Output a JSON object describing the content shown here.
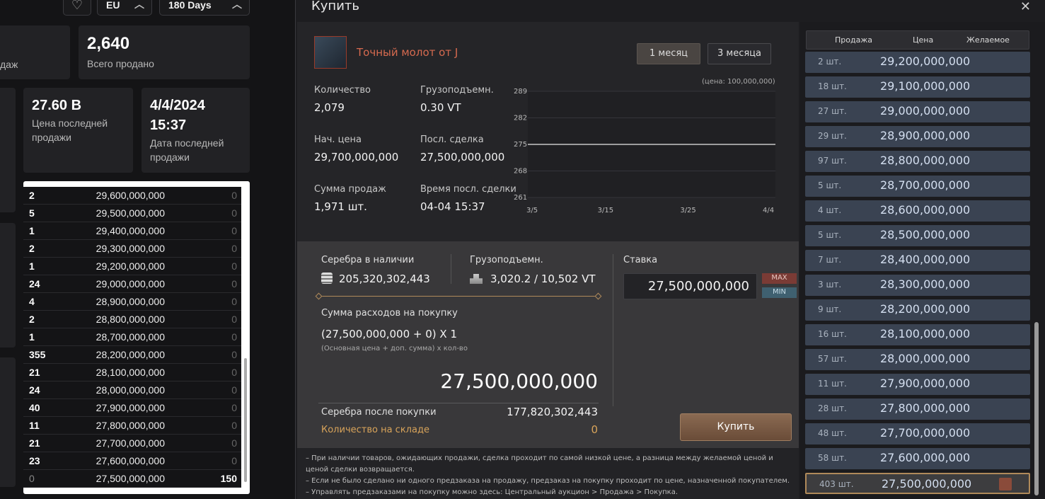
{
  "left_page": {
    "region": "EU",
    "period": "180 Days",
    "total_sold_value": "2,640",
    "total_sold_label": "Всего продано",
    "partial_label": "дaж",
    "last_price_value": "27.60 B",
    "last_price_label_1": "Цена последней",
    "last_price_label_2": "продажи",
    "last_date_value_1": "4/4/2024",
    "last_date_value_2": "15:37",
    "last_date_label_1": "Дата последней",
    "last_date_label_2": "продажи",
    "rows": [
      {
        "qty": "2",
        "price": "29,600,000,000",
        "wish": "0"
      },
      {
        "qty": "5",
        "price": "29,500,000,000",
        "wish": "0"
      },
      {
        "qty": "1",
        "price": "29,400,000,000",
        "wish": "0"
      },
      {
        "qty": "2",
        "price": "29,300,000,000",
        "wish": "0"
      },
      {
        "qty": "1",
        "price": "29,200,000,000",
        "wish": "0"
      },
      {
        "qty": "24",
        "price": "29,000,000,000",
        "wish": "0"
      },
      {
        "qty": "4",
        "price": "28,900,000,000",
        "wish": "0"
      },
      {
        "qty": "2",
        "price": "28,800,000,000",
        "wish": "0"
      },
      {
        "qty": "1",
        "price": "28,700,000,000",
        "wish": "0"
      },
      {
        "qty": "355",
        "price": "28,200,000,000",
        "wish": "0"
      },
      {
        "qty": "21",
        "price": "28,100,000,000",
        "wish": "0"
      },
      {
        "qty": "24",
        "price": "28,000,000,000",
        "wish": "0"
      },
      {
        "qty": "40",
        "price": "27,900,000,000",
        "wish": "0"
      },
      {
        "qty": "11",
        "price": "27,800,000,000",
        "wish": "0"
      },
      {
        "qty": "21",
        "price": "27,700,000,000",
        "wish": "0"
      },
      {
        "qty": "23",
        "price": "27,600,000,000",
        "wish": "0"
      },
      {
        "qty": "0",
        "price": "27,500,000,000",
        "wish": "150"
      }
    ]
  },
  "dialog": {
    "title": "Купить",
    "close": "✕",
    "item_name": "Точный молот от J",
    "tab_1": "1 месяц",
    "tab_3": "3 месяца",
    "chart_note": "(цена: 100,000,000)",
    "qty_label": "Количество",
    "qty_value": "2,079",
    "weight_label": "Грузоподъемн.",
    "weight_value": "0.30 VT",
    "start_price_label": "Нач. цена",
    "start_price_value": "29,700,000,000",
    "last_deal_label": "Посл. сделка",
    "last_deal_value": "27,500,000,000",
    "sales_label": "Сумма продаж",
    "sales_value": "1,971 шт.",
    "last_time_label": "Время посл. сделки",
    "last_time_value": "04-04 15:37",
    "silver_label": "Серебра в наличии",
    "silver_value": "205,320,302,443",
    "capacity_label": "Грузоподъемн.",
    "capacity_value": "3,020.2 / 10,502 VT",
    "bid_label": "Ставка",
    "bid_value": "27,500,000,000",
    "max": "MAX",
    "min": "MIN",
    "cost_label": "Сумма расходов на покупку",
    "formula": "(27,500,000,000 + 0) X 1",
    "formula_hint": "(Основная цена + доп. сумма) x кол-во",
    "total": "27,500,000,000",
    "after_label": "Серебра после покупки",
    "after_value": "177,820,302,443",
    "storage_label": "Количество на складе",
    "storage_value": "0",
    "buy_button": "Купить",
    "note_1": "– При наличии товаров, ожидающих продажи, сделка проходит по самой низкой цене, а разница между желаемой ценой и",
    "note_1b": "ценой сделки возвращается.",
    "note_2": "– Если не было сделано ни одного предзаказа на продажу, предзаказ на покупку проходит по цене, назначенной покупателем.",
    "note_3": "– Управлять предзаказами на покупку можно здесь: Центральный аукцион > Продажа > Покупка."
  },
  "chart_data": {
    "type": "line",
    "y_ticks": [
      "289",
      "282",
      "275",
      "268",
      "261"
    ],
    "x_ticks": [
      "3/5",
      "3/15",
      "3/25",
      "4/4"
    ],
    "ylim": [
      261,
      289
    ],
    "series": [
      {
        "values": [
          275,
          275
        ]
      }
    ]
  },
  "order_book": {
    "headers": [
      "Продажа",
      "Цена",
      "Желаемое"
    ],
    "rows": [
      {
        "qty": "2 шт.",
        "price": "29,200,000,000"
      },
      {
        "qty": "18 шт.",
        "price": "29,100,000,000"
      },
      {
        "qty": "27 шт.",
        "price": "29,000,000,000"
      },
      {
        "qty": "29 шт.",
        "price": "28,900,000,000"
      },
      {
        "qty": "97 шт.",
        "price": "28,800,000,000"
      },
      {
        "qty": "5 шт.",
        "price": "28,700,000,000"
      },
      {
        "qty": "4 шт.",
        "price": "28,600,000,000"
      },
      {
        "qty": "5 шт.",
        "price": "28,500,000,000"
      },
      {
        "qty": "7 шт.",
        "price": "28,400,000,000"
      },
      {
        "qty": "3 шт.",
        "price": "28,300,000,000"
      },
      {
        "qty": "9 шт.",
        "price": "28,200,000,000"
      },
      {
        "qty": "16 шт.",
        "price": "28,100,000,000"
      },
      {
        "qty": "57 шт.",
        "price": "28,000,000,000"
      },
      {
        "qty": "11 шт.",
        "price": "27,900,000,000"
      },
      {
        "qty": "28 шт.",
        "price": "27,800,000,000"
      },
      {
        "qty": "48 шт.",
        "price": "27,700,000,000"
      },
      {
        "qty": "58 шт.",
        "price": "27,600,000,000"
      },
      {
        "qty": "403 шт.",
        "price": "27,500,000,000"
      }
    ]
  }
}
